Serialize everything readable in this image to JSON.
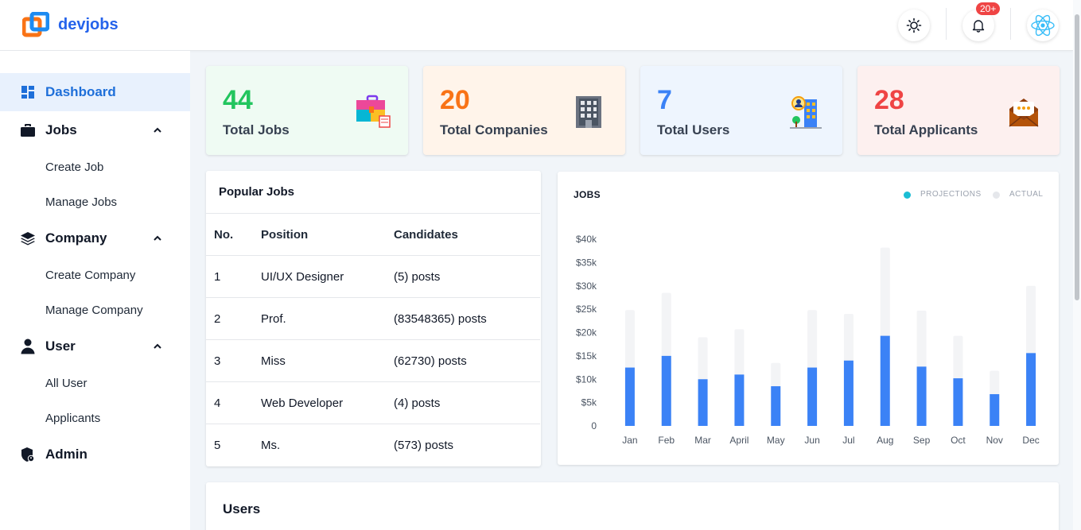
{
  "brand": {
    "name": "devjobs"
  },
  "header": {
    "theme_icon": "sun-icon",
    "notification_icon": "bell-icon",
    "notification_badge": "20+",
    "avatar_icon": "react-logo-icon"
  },
  "sidebar": {
    "items": [
      {
        "label": "Dashboard",
        "icon": "dashboard-icon",
        "active": true
      },
      {
        "label": "Jobs",
        "icon": "briefcase-icon",
        "expanded": true,
        "children": [
          "Create Job",
          "Manage Jobs"
        ]
      },
      {
        "label": "Company",
        "icon": "layers-icon",
        "expanded": true,
        "children": [
          "Create Company",
          "Manage Company"
        ]
      },
      {
        "label": "User",
        "icon": "user-icon",
        "expanded": true,
        "children": [
          "All User",
          "Applicants"
        ]
      },
      {
        "label": "Admin",
        "icon": "shield-user-icon"
      }
    ]
  },
  "stats": [
    {
      "value": "44",
      "label": "Total Jobs",
      "color": "#22c55e",
      "bg": "#effbf3",
      "icon": "briefcase-color-icon"
    },
    {
      "value": "20",
      "label": "Total Companies",
      "color": "#f97316",
      "bg": "#fff4ea",
      "icon": "office-building-icon"
    },
    {
      "value": "7",
      "label": "Total Users",
      "color": "#3b82f6",
      "bg": "#eef5fe",
      "icon": "user-building-icon"
    },
    {
      "value": "28",
      "label": "Total Applicants",
      "color": "#ef4444",
      "bg": "#fdf0ef",
      "icon": "mail-open-icon"
    }
  ],
  "popular_jobs": {
    "title": "Popular Jobs",
    "columns": [
      "No.",
      "Position",
      "Candidates"
    ],
    "rows": [
      [
        "1",
        "UI/UX Designer",
        "(5) posts"
      ],
      [
        "2",
        "Prof.",
        "(83548365) posts"
      ],
      [
        "3",
        "Miss",
        "(62730) posts"
      ],
      [
        "4",
        "Web Developer",
        "(4) posts"
      ],
      [
        "5",
        "Ms.",
        "(573) posts"
      ]
    ]
  },
  "chart_data": {
    "type": "bar",
    "title": "JOBS",
    "categories": [
      "Jan",
      "Feb",
      "Mar",
      "April",
      "May",
      "Jun",
      "Jul",
      "Aug",
      "Sep",
      "Oct",
      "Nov",
      "Dec"
    ],
    "series": [
      {
        "name": "PROJECTIONS",
        "color": "#3b82f6",
        "values": [
          12500,
          15000,
          10000,
          11000,
          8500,
          12500,
          14000,
          19300,
          12700,
          10200,
          6800,
          15600
        ]
      },
      {
        "name": "ACTUAL",
        "color": "#f3f4f6",
        "values": [
          24800,
          28500,
          19000,
          20700,
          13500,
          24800,
          24000,
          38200,
          24700,
          19300,
          11800,
          30000
        ]
      }
    ],
    "legend_colors": [
      "#1bbdd4",
      "#e5e7eb"
    ],
    "yticks": [
      "0",
      "$5k",
      "$10k",
      "$15k",
      "$20k",
      "$25k",
      "$30k",
      "$35k",
      "$40k"
    ],
    "ylim": [
      0,
      40000
    ],
    "grid": false,
    "legend": "top-right"
  },
  "users": {
    "title": "Users"
  }
}
